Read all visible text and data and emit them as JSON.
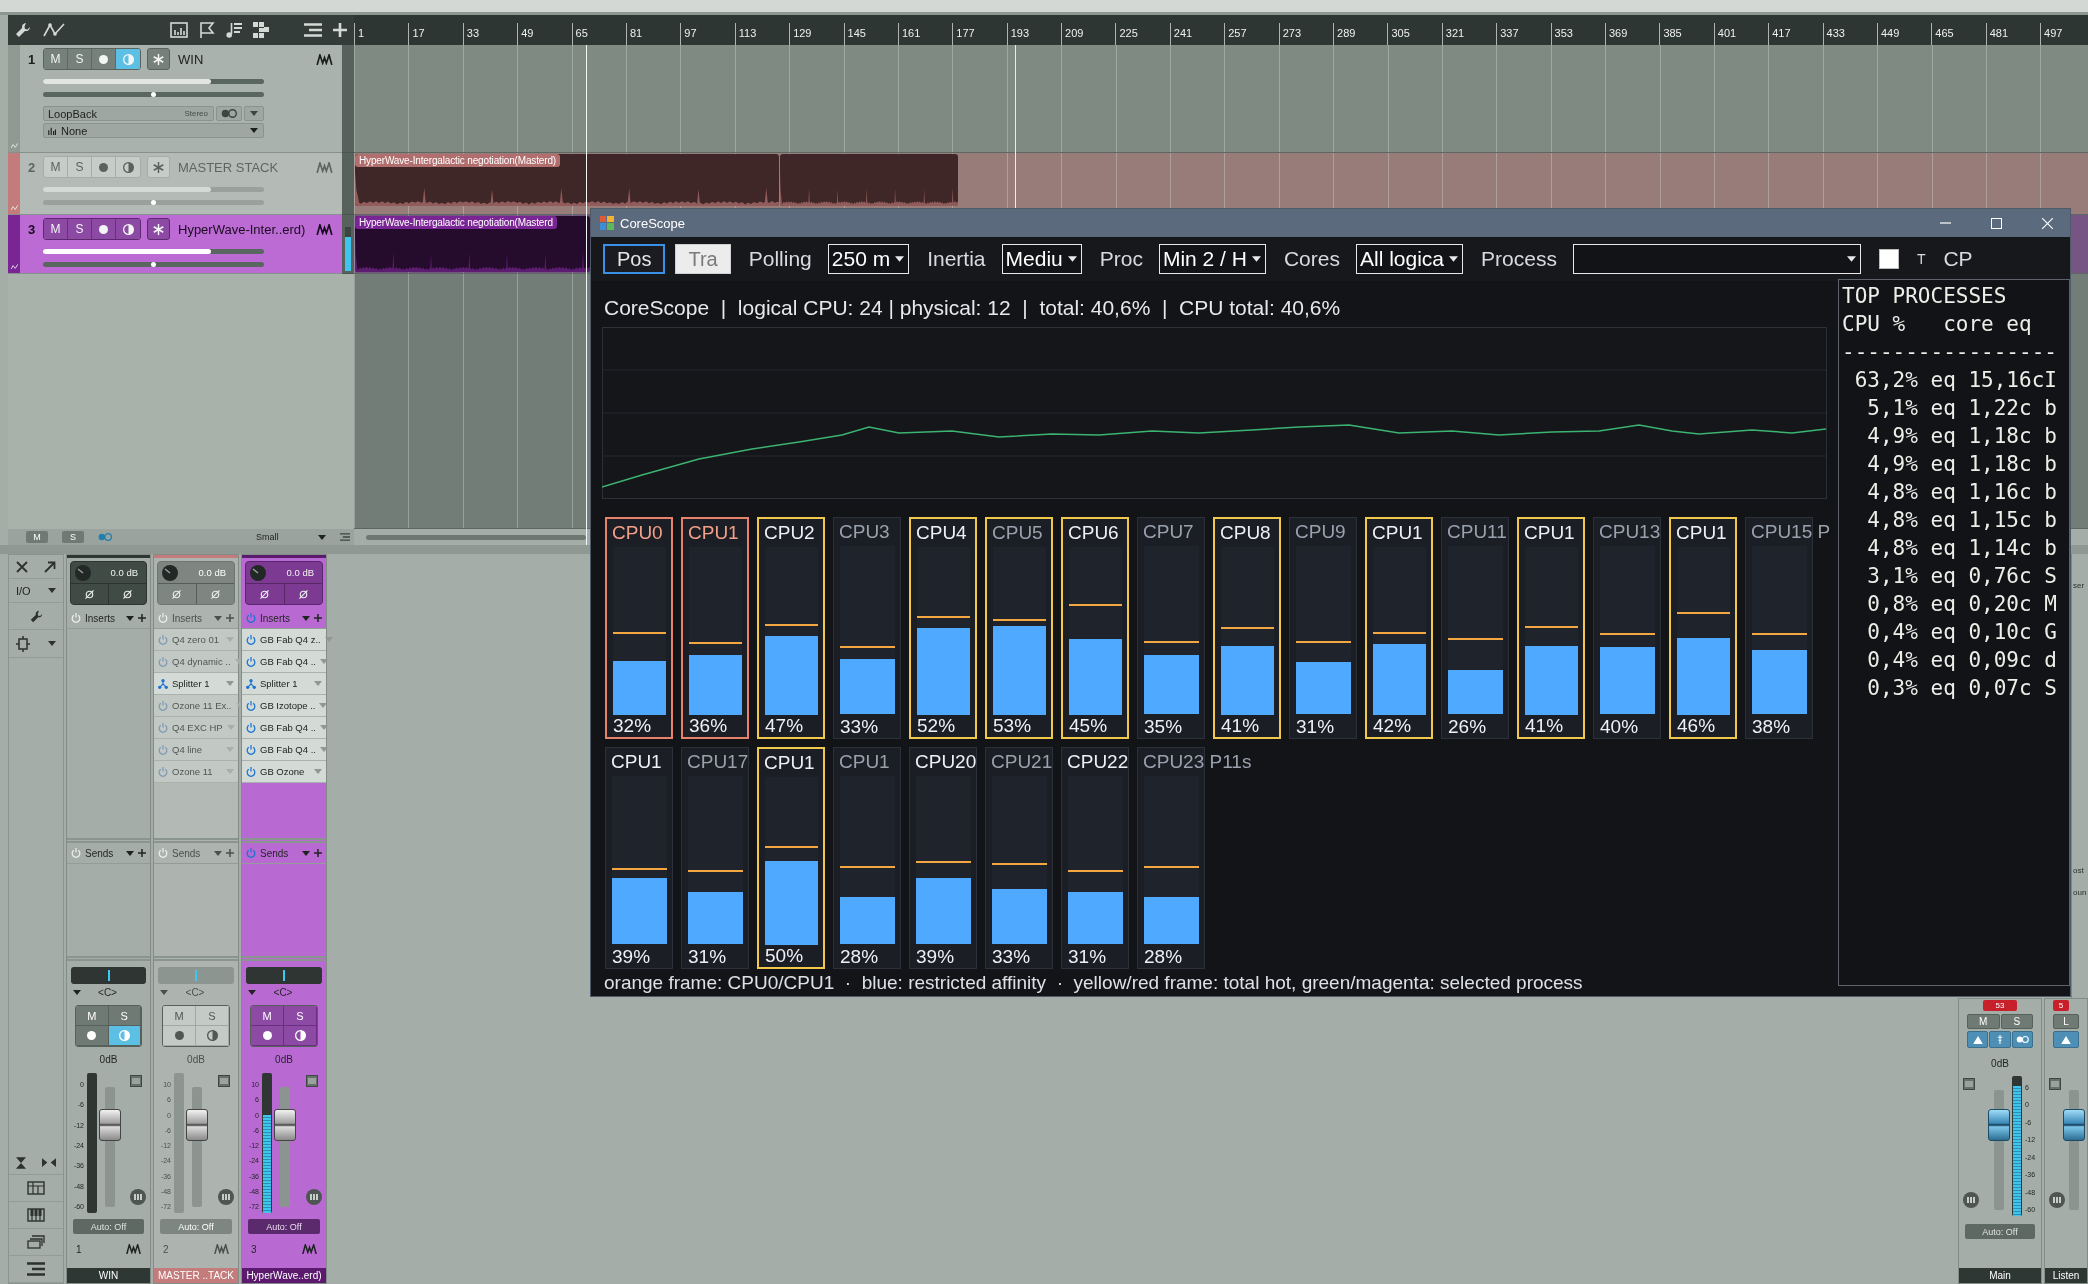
{
  "arrange": {
    "ruler": [
      "1",
      "17",
      "33",
      "49",
      "65",
      "81",
      "97",
      "113",
      "129",
      "145",
      "161",
      "177",
      "193",
      "209",
      "225",
      "241",
      "257",
      "273",
      "289",
      "305",
      "321",
      "337",
      "353",
      "369",
      "385",
      "401",
      "417",
      "433",
      "449",
      "465",
      "481",
      "497"
    ],
    "tracks": [
      {
        "number": "1",
        "name": "WIN",
        "color": "#8f9a93",
        "selected": false,
        "disabled": false,
        "mute": "M",
        "solo": "S",
        "monitoring": true,
        "volume": {
          "level": 0.76
        },
        "pan": {
          "level": 0.5
        },
        "input": {
          "name": "LoopBack",
          "format": "Stereo"
        },
        "output": {
          "name": "None"
        }
      },
      {
        "number": "2",
        "name": "MASTER STACK",
        "color": "#c47b7b",
        "selected": false,
        "disabled": true,
        "mute": "M",
        "solo": "S",
        "monitoring": false,
        "volume": {
          "level": 0.76
        },
        "pan": {
          "level": 0.5
        },
        "clips": [
          {
            "kind": "titled",
            "title": "HyperWave-Intergalactic negotiation(Masterd)"
          },
          {
            "kind": "plain"
          }
        ]
      },
      {
        "number": "3",
        "name": "HyperWave-Inter..erd)",
        "color": "#7a2594",
        "selected": true,
        "disabled": false,
        "mute": "M",
        "solo": "S",
        "monitoring": false,
        "volume": {
          "level": 0.76
        },
        "pan": {
          "level": 0.5
        },
        "meter": {
          "level": 0.78
        },
        "clips": [
          {
            "kind": "titled",
            "title": "HyperWave-Intergalactic negotiation(Masterd"
          }
        ]
      }
    ],
    "footer": {
      "mute": "M",
      "solo": "S",
      "size": "Small"
    }
  },
  "mixer": {
    "io_label": "I/O",
    "channels": [
      {
        "number": "1",
        "name": "WIN",
        "color": "#2e3733",
        "selected": false,
        "disabled": false,
        "gain": "0.0 dB",
        "inserts_label": "Inserts",
        "sends_label": "Sends",
        "pan": {
          "level": 0.5,
          "reading": "<C>"
        },
        "mute": "M",
        "solo": "S",
        "monitoring": true,
        "volume": "0dB",
        "fader": {
          "level": 0.75
        },
        "scale": [
          "0",
          "-6",
          "-12",
          "-24",
          "-36",
          "-48",
          "-60"
        ],
        "automation": "Auto: Off"
      },
      {
        "number": "2",
        "name": "MASTER ..TACK",
        "color": "#c47b7b",
        "selected": false,
        "disabled": true,
        "gain": "0.0 dB",
        "inserts_label": "Inserts",
        "inserts": [
          {
            "kind": "plugin",
            "name": "Q4 zero 01",
            "active": false
          },
          {
            "kind": "plugin",
            "name": "Q4 dynamic ..",
            "active": false
          },
          {
            "kind": "splitter",
            "name": "Splitter 1",
            "active": true
          },
          {
            "kind": "plugin",
            "name": "Ozone 11 Ex..",
            "active": false
          },
          {
            "kind": "plugin",
            "name": "Q4 EXC HP",
            "active": false
          },
          {
            "kind": "plugin",
            "name": "Q4 line",
            "active": false
          },
          {
            "kind": "plugin",
            "name": "Ozone 11",
            "active": false
          }
        ],
        "sends_label": "Sends",
        "pan": {
          "level": 0.5,
          "reading": "<C>"
        },
        "mute": "M",
        "solo": "S",
        "monitoring": false,
        "volume": "0dB",
        "fader": {
          "level": 0.75
        },
        "scale": [
          "10",
          "6",
          "0",
          "-6",
          "-12",
          "-24",
          "-36",
          "-48",
          "-72"
        ],
        "automation": "Auto: Off"
      },
      {
        "number": "3",
        "name": "HyperWave..erd)",
        "color": "#5b1a6e",
        "selected": true,
        "disabled": false,
        "gain": "0.0 dB",
        "inserts_label": "Inserts",
        "inserts": [
          {
            "kind": "plugin",
            "name": "GB Fab Q4 z..",
            "active": true
          },
          {
            "kind": "plugin",
            "name": "GB Fab Q4 ..",
            "active": true
          },
          {
            "kind": "splitter",
            "name": "Splitter 1",
            "active": true
          },
          {
            "kind": "plugin",
            "name": "GB Izotope ..",
            "active": true
          },
          {
            "kind": "plugin",
            "name": "GB Fab Q4 ..",
            "active": true
          },
          {
            "kind": "plugin",
            "name": "GB Fab Q4 ..",
            "active": true
          },
          {
            "kind": "plugin",
            "name": "GB Ozone",
            "active": true
          }
        ],
        "sends_label": "Sends",
        "pan": {
          "level": 0.5,
          "reading": "<C>"
        },
        "mute": "M",
        "solo": "S",
        "monitoring": false,
        "volume": "0dB",
        "fader": {
          "level": 0.75
        },
        "meter": {
          "level": 0.7
        },
        "scale": [
          "10",
          "6",
          "0",
          "-6",
          "-12",
          "-24",
          "-36",
          "-48",
          "-72"
        ],
        "automation": "Auto: Off"
      }
    ],
    "outputs": [
      {
        "name": "Main",
        "peak": "53",
        "mute": "M",
        "solo": "S",
        "volume": "0dB",
        "fader": {
          "level": 0.78
        },
        "meter": {
          "level": 0.93
        },
        "scale": [
          "6",
          "0",
          "-6",
          "-12",
          "-24",
          "-36",
          "-48",
          "-60"
        ],
        "automation": "Auto: Off"
      },
      {
        "name": "Listen",
        "peak": "5",
        "mute": "L",
        "fader": {
          "level": 0.78
        }
      }
    ]
  },
  "side_panel": {
    "texts": [
      "ser",
      "ost",
      "oun"
    ]
  },
  "corescope": {
    "title": "CoreScope",
    "toolbar": [
      {
        "kind": "button",
        "label": "Pos",
        "focused": true,
        "disabled": false
      },
      {
        "kind": "button",
        "label": "Tra",
        "focused": false,
        "disabled": true
      },
      {
        "kind": "label",
        "text": "Polling"
      },
      {
        "kind": "combo",
        "value": "250 m"
      },
      {
        "kind": "label",
        "text": "Inertia"
      },
      {
        "kind": "combo",
        "value": "Mediu"
      },
      {
        "kind": "label",
        "text": "Proc"
      },
      {
        "kind": "combo",
        "value": "Min 2 / H"
      },
      {
        "kind": "label",
        "text": "Cores"
      },
      {
        "kind": "combo",
        "value": "All logica"
      },
      {
        "kind": "label",
        "text": "Process"
      },
      {
        "kind": "process_combo"
      },
      {
        "kind": "checkbox",
        "label": "T",
        "checked": false
      },
      {
        "kind": "label",
        "text": "CP"
      }
    ],
    "summary": "CoreScope  |  logical CPU: 24 | physical: 12  |  total: 40,6%  |  CPU total: 40,6%",
    "cpus": [
      {
        "label": "CPU0",
        "percent": "32%",
        "level": 0.32,
        "peak": {
          "level": 0.48
        },
        "kind": "system",
        "dimmed": false
      },
      {
        "label": "CPU1",
        "percent": "36%",
        "level": 0.36,
        "peak": {
          "level": 0.42
        },
        "kind": "system",
        "dimmed": false
      },
      {
        "label": "CPU2",
        "percent": "47%",
        "level": 0.47,
        "peak": {
          "level": 0.53
        },
        "kind": "hot",
        "dimmed": false
      },
      {
        "label": "CPU3",
        "percent": "33%",
        "level": 0.33,
        "peak": {
          "level": 0.39
        },
        "kind": "normal",
        "dimmed": true
      },
      {
        "label": "CPU4",
        "percent": "52%",
        "level": 0.52,
        "peak": {
          "level": 0.58
        },
        "kind": "hot",
        "dimmed": false
      },
      {
        "label": "CPU5",
        "percent": "53%",
        "level": 0.53,
        "peak": {
          "level": 0.56
        },
        "kind": "hot",
        "dimmed": true
      },
      {
        "label": "CPU6",
        "percent": "45%",
        "level": 0.45,
        "peak": {
          "level": 0.65
        },
        "kind": "hot",
        "dimmed": false
      },
      {
        "label": "CPU7",
        "percent": "35%",
        "level": 0.35,
        "peak": {
          "level": 0.42
        },
        "kind": "normal",
        "dimmed": true
      },
      {
        "label": "CPU8",
        "percent": "41%",
        "level": 0.41,
        "peak": {
          "level": 0.51
        },
        "kind": "hot",
        "dimmed": false
      },
      {
        "label": "CPU9",
        "percent": "31%",
        "level": 0.31,
        "peak": {
          "level": 0.42
        },
        "kind": "normal",
        "dimmed": true
      },
      {
        "label": "CPU1",
        "percent": "42%",
        "level": 0.42,
        "peak": {
          "level": 0.48
        },
        "kind": "hot",
        "dimmed": false
      },
      {
        "label": "CPU11",
        "percent": "26%",
        "level": 0.26,
        "peak": {
          "level": 0.44
        },
        "kind": "normal",
        "dimmed": true
      },
      {
        "label": "CPU1",
        "percent": "41%",
        "level": 0.41,
        "peak": {
          "level": 0.52
        },
        "kind": "hot",
        "dimmed": false
      },
      {
        "label": "CPU13",
        "percent": "40%",
        "level": 0.4,
        "peak": {
          "level": 0.47
        },
        "kind": "normal",
        "dimmed": true
      },
      {
        "label": "CPU1",
        "percent": "46%",
        "level": 0.46,
        "peak": {
          "level": 0.6
        },
        "kind": "hot",
        "dimmed": false
      },
      {
        "label": "CPU15 P",
        "percent": "38%",
        "level": 0.38,
        "peak": {
          "level": 0.47
        },
        "kind": "normal",
        "dimmed": true
      },
      {
        "label": "CPU1",
        "percent": "39%",
        "level": 0.39,
        "peak": {
          "level": 0.44
        },
        "kind": "normal",
        "dimmed": false
      },
      {
        "label": "CPU17",
        "percent": "31%",
        "level": 0.31,
        "peak": {
          "level": 0.43
        },
        "kind": "normal",
        "dimmed": true
      },
      {
        "label": "CPU1",
        "percent": "50%",
        "level": 0.5,
        "peak": {
          "level": 0.58
        },
        "kind": "hot",
        "dimmed": false
      },
      {
        "label": "CPU1",
        "percent": "28%",
        "level": 0.28,
        "peak": {
          "level": 0.45
        },
        "kind": "normal",
        "dimmed": true
      },
      {
        "label": "CPU20",
        "percent": "39%",
        "level": 0.39,
        "peak": {
          "level": 0.48
        },
        "kind": "normal",
        "dimmed": false
      },
      {
        "label": "CPU21",
        "percent": "33%",
        "level": 0.33,
        "peak": {
          "level": 0.47
        },
        "kind": "normal",
        "dimmed": true
      },
      {
        "label": "CPU22",
        "percent": "31%",
        "level": 0.31,
        "peak": {
          "level": 0.43
        },
        "kind": "normal",
        "dimmed": false
      },
      {
        "label": "CPU23 P11s",
        "percent": "28%",
        "level": 0.28,
        "peak": {
          "level": 0.45
        },
        "kind": "normal",
        "dimmed": true
      }
    ],
    "legend": "orange frame: CPU0/CPU1  ·  blue: restricted affinity  ·  yellow/red frame: total hot, green/magenta: selected process",
    "top_processes": {
      "title": "TOP PROCESSES",
      "header": "CPU %   core eq",
      "divider": "-----------------",
      "rows": [
        {
          "cpu": "63,2%",
          "detail": "eq 15,16cI"
        },
        {
          "cpu": "5,1%",
          "detail": "eq 1,22c b"
        },
        {
          "cpu": "4,9%",
          "detail": "eq 1,18c b"
        },
        {
          "cpu": "4,9%",
          "detail": "eq 1,18c b"
        },
        {
          "cpu": "4,8%",
          "detail": "eq 1,16c b"
        },
        {
          "cpu": "4,8%",
          "detail": "eq 1,15c b"
        },
        {
          "cpu": "4,8%",
          "detail": "eq 1,14c b"
        },
        {
          "cpu": "3,1%",
          "detail": "eq 0,76c S"
        },
        {
          "cpu": "0,8%",
          "detail": "eq 0,20c M"
        },
        {
          "cpu": "0,4%",
          "detail": "eq 0,10c G"
        },
        {
          "cpu": "0,4%",
          "detail": "eq 0,09c d"
        },
        {
          "cpu": "0,3%",
          "detail": "eq 0,07c S"
        }
      ]
    }
  }
}
